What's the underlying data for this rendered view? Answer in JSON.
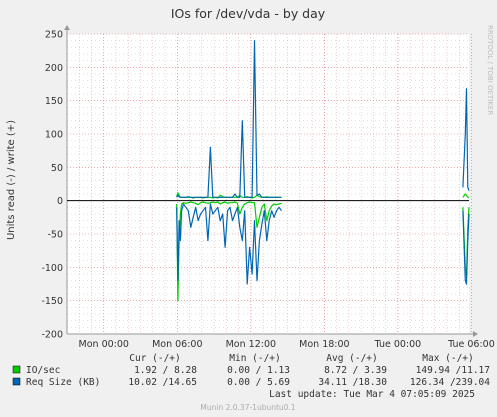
{
  "chart_data": {
    "type": "line",
    "title": "IOs for /dev/vda - by day",
    "ylabel": "Units read (-) / write (+)",
    "watermark": "RRDTOOL / TOBI OETIKER",
    "ylim": [
      -200,
      250
    ],
    "yticks": [
      -200,
      -150,
      -100,
      -50,
      0,
      50,
      100,
      150,
      200,
      250
    ],
    "xlim_hours": [
      0,
      32.8
    ],
    "xticks": [
      {
        "h": 3,
        "label": "Mon 00:00"
      },
      {
        "h": 9,
        "label": "Mon 06:00"
      },
      {
        "h": 15,
        "label": "Mon 12:00"
      },
      {
        "h": 21,
        "label": "Mon 18:00"
      },
      {
        "h": 27,
        "label": "Tue 00:00"
      },
      {
        "h": 33,
        "label": "Tue 06:00"
      }
    ],
    "grid": true,
    "series": [
      {
        "name": "IO/sec",
        "color": "#00cc00",
        "segments": [
          {
            "x": [
              8.95,
              9.05,
              9.15,
              9.25,
              9.35,
              9.5,
              9.7,
              9.9,
              10.1,
              10.3,
              10.5,
              10.7,
              10.9,
              11.1,
              11.3,
              11.5,
              11.7,
              11.9,
              12.1,
              12.3,
              12.5,
              12.7,
              12.9,
              13.1,
              13.3,
              13.5,
              13.7,
              13.9,
              14.1,
              14.3,
              14.5,
              14.7,
              14.9,
              15.1,
              15.3,
              15.5,
              15.7,
              15.9,
              16.1,
              16.3,
              16.5,
              16.7,
              16.9,
              17.1,
              17.3,
              17.5
            ],
            "read": [
              -5,
              -150,
              -60,
              -20,
              -5,
              -3,
              -4,
              -3,
              -2,
              -3,
              -4,
              -6,
              -3,
              -2,
              -3,
              -4,
              -3,
              -2,
              -3,
              -2,
              -5,
              -3,
              -2,
              -4,
              -3,
              -3,
              -2,
              -4,
              -20,
              -10,
              -5,
              -3,
              -2,
              -3,
              -3,
              -40,
              -25,
              -10,
              -5,
              -30,
              -15,
              -8,
              -5,
              -6,
              -5,
              -4
            ],
            "write": [
              6,
              12,
              8,
              5,
              5,
              5,
              5,
              5,
              5,
              4,
              5,
              5,
              5,
              4,
              5,
              5,
              5,
              4,
              5,
              4,
              8,
              6,
              5,
              5,
              5,
              5,
              5,
              5,
              8,
              5,
              5,
              6,
              5,
              4,
              5,
              8,
              6,
              5,
              5,
              6,
              5,
              5,
              5,
              5,
              5,
              5
            ]
          },
          {
            "x": [
              32.3,
              32.5,
              32.6,
              32.7,
              32.8
            ],
            "read": [
              -10,
              -100,
              -115,
              -40,
              -10
            ],
            "write": [
              5,
              10,
              8,
              5,
              5
            ]
          }
        ]
      },
      {
        "name": "Req Size (KB)",
        "color": "#0066b3",
        "segments": [
          {
            "x": [
              8.95,
              9.05,
              9.15,
              9.25,
              9.35,
              9.5,
              9.7,
              9.9,
              10.1,
              10.3,
              10.5,
              10.7,
              10.9,
              11.1,
              11.3,
              11.5,
              11.7,
              11.9,
              12.1,
              12.3,
              12.5,
              12.7,
              12.9,
              13.1,
              13.3,
              13.5,
              13.7,
              13.9,
              14.1,
              14.3,
              14.5,
              14.7,
              14.9,
              15.1,
              15.3,
              15.5,
              15.7,
              15.9,
              16.1,
              16.3,
              16.5,
              16.7,
              16.9,
              17.1,
              17.3,
              17.5
            ],
            "read": [
              -10,
              -120,
              -30,
              -60,
              -15,
              -5,
              -10,
              -15,
              -40,
              -25,
              -10,
              -30,
              -20,
              -15,
              -10,
              -60,
              -5,
              -20,
              -15,
              -10,
              -30,
              -20,
              -70,
              -15,
              -10,
              -30,
              -20,
              -10,
              -40,
              -60,
              -15,
              -125,
              -70,
              -110,
              -30,
              -120,
              -60,
              -35,
              -15,
              -60,
              -30,
              -15,
              -25,
              -15,
              -10,
              -15
            ],
            "write": [
              5,
              8,
              6,
              5,
              5,
              5,
              5,
              6,
              5,
              5,
              5,
              5,
              5,
              5,
              5,
              5,
              80,
              5,
              5,
              5,
              5,
              5,
              5,
              5,
              5,
              5,
              10,
              5,
              5,
              120,
              5,
              5,
              5,
              5,
              240,
              8,
              10,
              5,
              5,
              5,
              5,
              5,
              5,
              5,
              5,
              5
            ]
          },
          {
            "x": [
              32.3,
              32.5,
              32.6,
              32.7,
              32.8
            ],
            "read": [
              -15,
              -120,
              -125,
              -60,
              -20
            ],
            "write": [
              20,
              100,
              168,
              20,
              15
            ]
          }
        ]
      }
    ]
  },
  "legend": {
    "headers": [
      "Cur (-/+)",
      "Min (-/+)",
      "Avg (-/+)",
      "Max (-/+)"
    ],
    "rows": [
      {
        "label": "IO/sec",
        "color": "#00cc00",
        "cur": "1.92 / 8.28",
        "min": "0.00 / 1.13",
        "avg": "8.72 / 3.39",
        "max": "149.94 /11.17"
      },
      {
        "label": "Req Size (KB)",
        "color": "#0066b3",
        "cur": "10.02 /14.65",
        "min": "0.00 / 5.69",
        "avg": "34.11 /18.30",
        "max": "126.34 /239.04"
      }
    ],
    "last_update": "Last update: Tue Mar  4 07:05:09 2025"
  },
  "footer": "Munin 2.0.37-1ubuntu0.1",
  "colors": {
    "background": "#f0f0f0",
    "plot_background": "#ffffff",
    "grid_major": "#e07070",
    "grid_minor": "#e0a0a0",
    "zero_line": "#000000"
  }
}
